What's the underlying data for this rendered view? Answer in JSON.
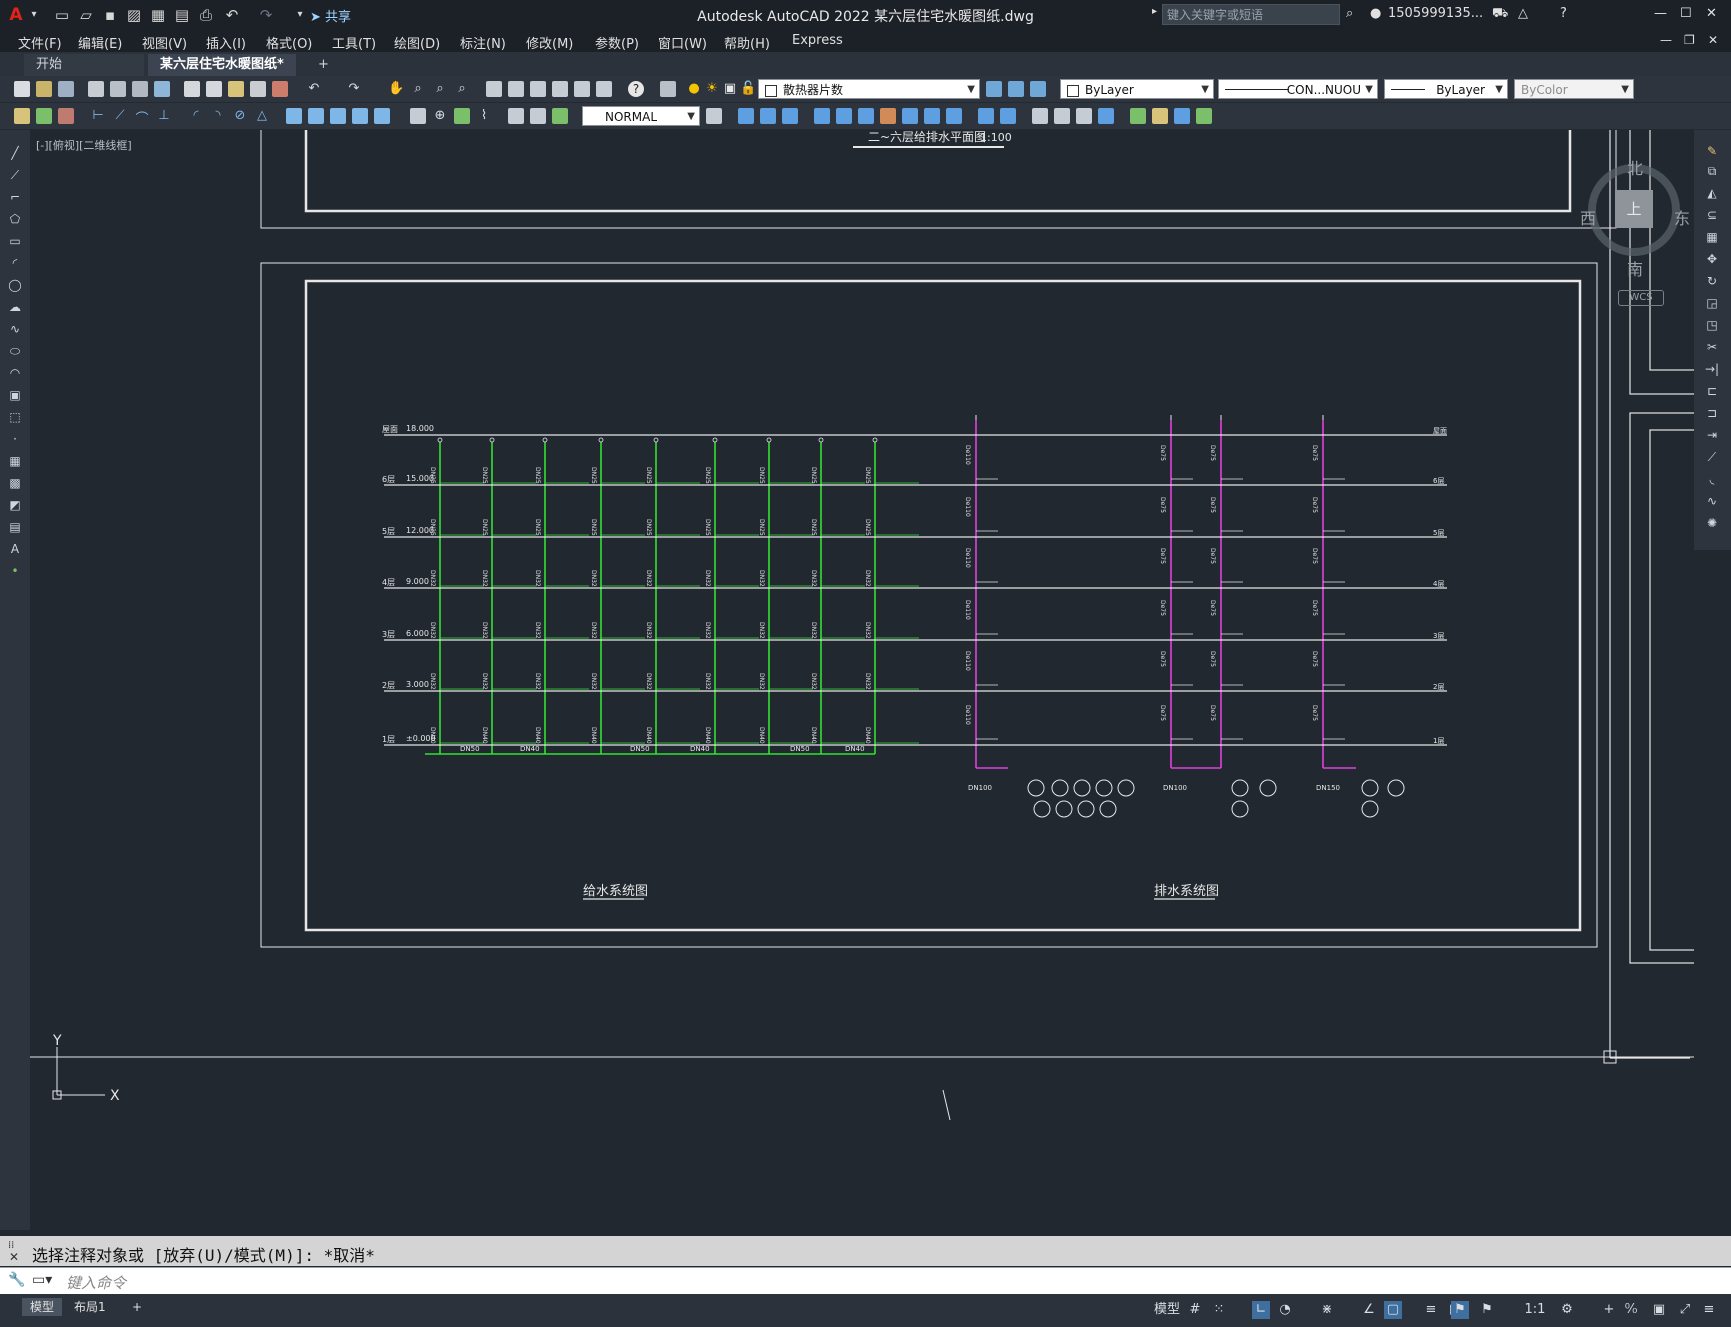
{
  "app": {
    "title": "Autodesk AutoCAD 2022    某六层住宅水暖图纸.dwg",
    "share_label": "共享",
    "search_placeholder": "键入关键字或短语",
    "user": "1505999135...",
    "window_controls": [
      "minimize",
      "maximize",
      "close"
    ]
  },
  "menu": [
    "文件(F)",
    "编辑(E)",
    "视图(V)",
    "插入(I)",
    "格式(O)",
    "工具(T)",
    "绘图(D)",
    "标注(N)",
    "修改(M)",
    "参数(P)",
    "窗口(W)",
    "帮助(H)",
    "Express"
  ],
  "tabs": [
    {
      "label": "开始",
      "active": false
    },
    {
      "label": "某六层住宅水暖图纸*",
      "active": true
    }
  ],
  "toolbar": {
    "layer_name": "散热器片数",
    "color": "ByLayer",
    "linetype": "CON...NUOU",
    "lineweight": "ByLayer",
    "plotstyle": "ByColor",
    "textstyle": "NORMAL"
  },
  "viewport_label": "[-][俯视][二维线框]",
  "viewcube": {
    "north": "北",
    "south": "南",
    "east": "东",
    "west": "西",
    "top": "上",
    "wcs": "WCS"
  },
  "drawing": {
    "top_title": "二~六层给排水平面图",
    "top_scale": "1:100",
    "supply_title": "给水系统图",
    "drain_title": "排水系统图",
    "floor_elevations": [
      "18.000",
      "15.000",
      "12.000",
      "9.000",
      "6.000",
      "3.000",
      "±0.000"
    ],
    "floor_tags": [
      "屋面",
      "6层",
      "5层",
      "4层",
      "3层",
      "2层",
      "1层"
    ],
    "supply_pipe_sizes": [
      "DN25",
      "DN32",
      "DN40",
      "DN50"
    ],
    "drain_pipe_sizes": [
      "De110",
      "De75",
      "DN100",
      "DN150"
    ],
    "axis_x": "X",
    "axis_y": "Y"
  },
  "colors": {
    "supply": "#33e033",
    "drain": "#e040e0",
    "line": "#e6e6e6",
    "frame": "#e6e6e6"
  },
  "command": {
    "history": "选择注释对象或 [放弃(U)/模式(M)]: *取消*",
    "placeholder": "键入命令"
  },
  "statusbar": {
    "layouts": [
      {
        "label": "模型",
        "active": true
      },
      {
        "label": "布局1",
        "active": false
      }
    ],
    "model_label": "模型",
    "scale": "1:1"
  }
}
